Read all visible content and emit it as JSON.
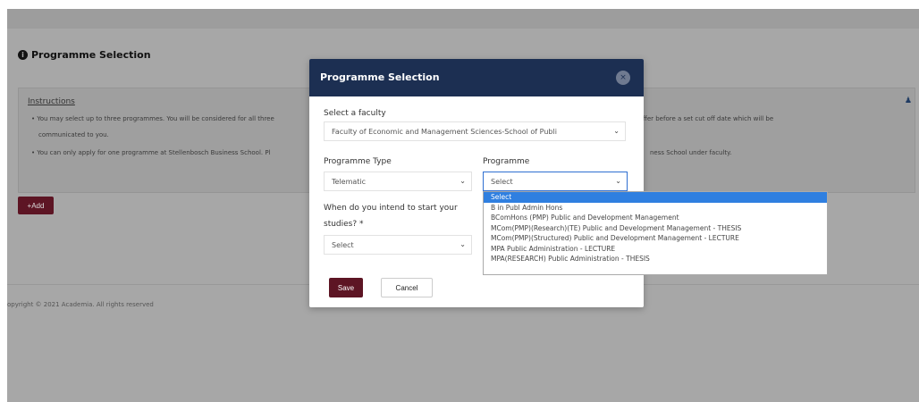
{
  "page": {
    "section_title": "Programme Selection",
    "instructions_label": "Instructions",
    "instructions": [
      "•  You may select up to three programmes. You will be considered for all three",
      "communicated to you.",
      "•  You can only apply for one programme at Stellenbosch Business School. Pl"
    ],
    "instructions_right": [
      "ffer before a set cut off date which will be",
      "ness School under faculty."
    ],
    "add_label": "+Add",
    "copyright": "opyright © 2021 Academia. All rights reserved"
  },
  "modal": {
    "title": "Programme Selection",
    "close_label": "×",
    "faculty_label": "Select a faculty",
    "faculty_value": "Faculty of Economic and Management Sciences-School of Publi",
    "programme_type_label": "Programme Type",
    "programme_type_value": "Telematic",
    "programme_label": "Programme",
    "programme_value": "Select",
    "start_label_line1": "When do you intend to start your",
    "start_label_line2": "studies? *",
    "start_value": "Select",
    "save_label": "Save",
    "cancel_label": "Cancel"
  },
  "dropdown": {
    "options": [
      "Select",
      "B in Publ Admin Hons",
      "BComHons (PMP) Public and Development Management",
      "MCom(PMP)(Research)(TE) Public and Development Management - THESIS",
      "MCom(PMP)(Structured) Public and Development Management - LECTURE",
      "MPA Public Administration - LECTURE",
      "MPA(RESEARCH) Public Administration - THESIS"
    ],
    "selected_index": 0
  },
  "colors": {
    "modal_header": "#1c2f52",
    "primary_button": "#5d1524",
    "selection_highlight": "#2f7fe0",
    "overlay": "#a7a7a7"
  }
}
